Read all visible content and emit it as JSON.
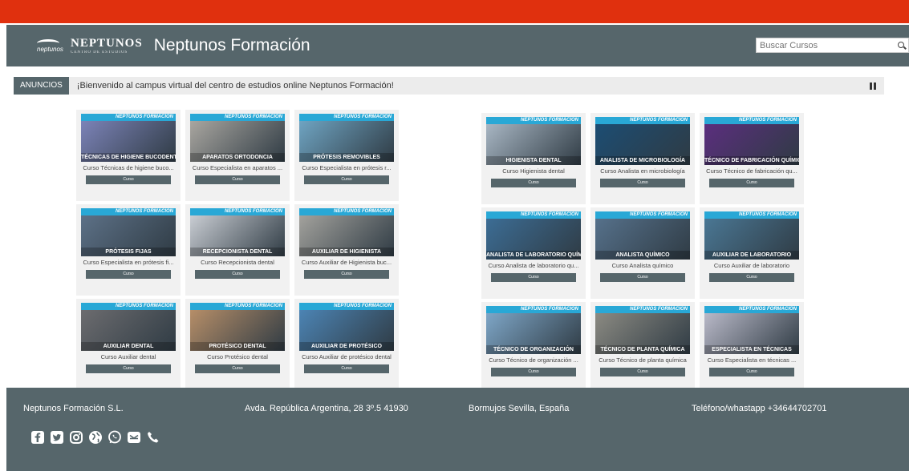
{
  "header": {
    "logo_main": "NEPTUNOS",
    "logo_sub": "CENTRO DE ESTUDIOS",
    "logo_badge": "neptunos",
    "site_title": "Neptunos Formación",
    "search_placeholder": "Buscar Cursos"
  },
  "news": {
    "label": "ANUNCIOS",
    "text": "¡Bienvenido al campus virtual del centro de estudios online Neptunos Formación!"
  },
  "thumb_brand": "NEPTUNOS FORMACIÓN",
  "button_label": "Curso",
  "left_courses": [
    {
      "title": "Curso Técnicas de higiene buco...",
      "caption": "TÉCNICAS DE HIGIENE BUCODENTAL",
      "color": "#7c83b8"
    },
    {
      "title": "Curso Especialista en aparatos ...",
      "caption": "APARATOS ORTODONCIA",
      "color": "#a9a6a0"
    },
    {
      "title": "Curso Especialista en prótesis r...",
      "caption": "PRÓTESIS REMOVIBLES",
      "color": "#6fa4c2"
    },
    {
      "title": "Curso Especialista en prótesis fi...",
      "caption": "PRÓTESIS FIJAS",
      "color": "#5d7187"
    },
    {
      "title": "Curso Recepcionista dental",
      "caption": "RECEPCIONISTA DENTAL",
      "color": "#c9cdd3"
    },
    {
      "title": "Curso Auxiliar de Higienista buc...",
      "caption": "AUXILIAR DE HIGIENISTA",
      "color": "#a3a29d"
    },
    {
      "title": "Curso Auxiliar dental",
      "caption": "AUXILIAR DENTAL",
      "color": "#6c6c6f"
    },
    {
      "title": "Curso Protésico dental",
      "caption": "PROTÉSICO DENTAL",
      "color": "#b68e68"
    },
    {
      "title": "Curso Auxiliar de protésico dental",
      "caption": "AUXILIAR DE PROTÉSICO",
      "color": "#4c84b4"
    }
  ],
  "right_courses": [
    {
      "title": "Curso Higienista dental",
      "caption": "HIGIENISTA DENTAL",
      "color": "#a8b6c3"
    },
    {
      "title": "Curso Analista en microbiología",
      "caption": "ANALISTA DE MICROBIOLOGÍA",
      "color": "#1c4d73"
    },
    {
      "title": "Curso Técnico de fabricación qu...",
      "caption": "TÉCNICO DE FABRICACIÓN QUÍMICA",
      "color": "#5b2e7e"
    },
    {
      "title": "Curso Analista de laboratorio qu...",
      "caption": "ANALISTA DE LABORATORIO QUÍMICO",
      "color": "#3c6d95"
    },
    {
      "title": "Curso Analista químico",
      "caption": "ANALISTA QUÍMICO",
      "color": "#56718b"
    },
    {
      "title": "Curso Auxiliar de laboratorio",
      "caption": "AUXILIAR DE LABORATORIO",
      "color": "#4a7794"
    },
    {
      "title": "Curso Técnico de organización ...",
      "caption": "TÉCNICO DE ORGANIZACIÓN",
      "color": "#7ea6c7"
    },
    {
      "title": "Curso Técnico de planta química",
      "caption": "TÉCNICO DE PLANTA QUÍMICA",
      "color": "#8b8a82"
    },
    {
      "title": "Curso Especialista en técnicas ...",
      "caption": "ESPECIALISTA EN TÉCNICAS",
      "color": "#b9b9c8"
    }
  ],
  "footer": {
    "company": "Neptunos Formación S.L.",
    "address": "Avda. República Argentina, 28 3º.5 41930",
    "city": "Bormujos Sevilla, España",
    "phone": "Teléfono/whastapp +34644702701"
  },
  "socials": [
    "facebook-icon",
    "twitter-icon",
    "instagram-icon",
    "globe-icon",
    "whatsapp-icon",
    "email-icon",
    "phone-icon"
  ]
}
